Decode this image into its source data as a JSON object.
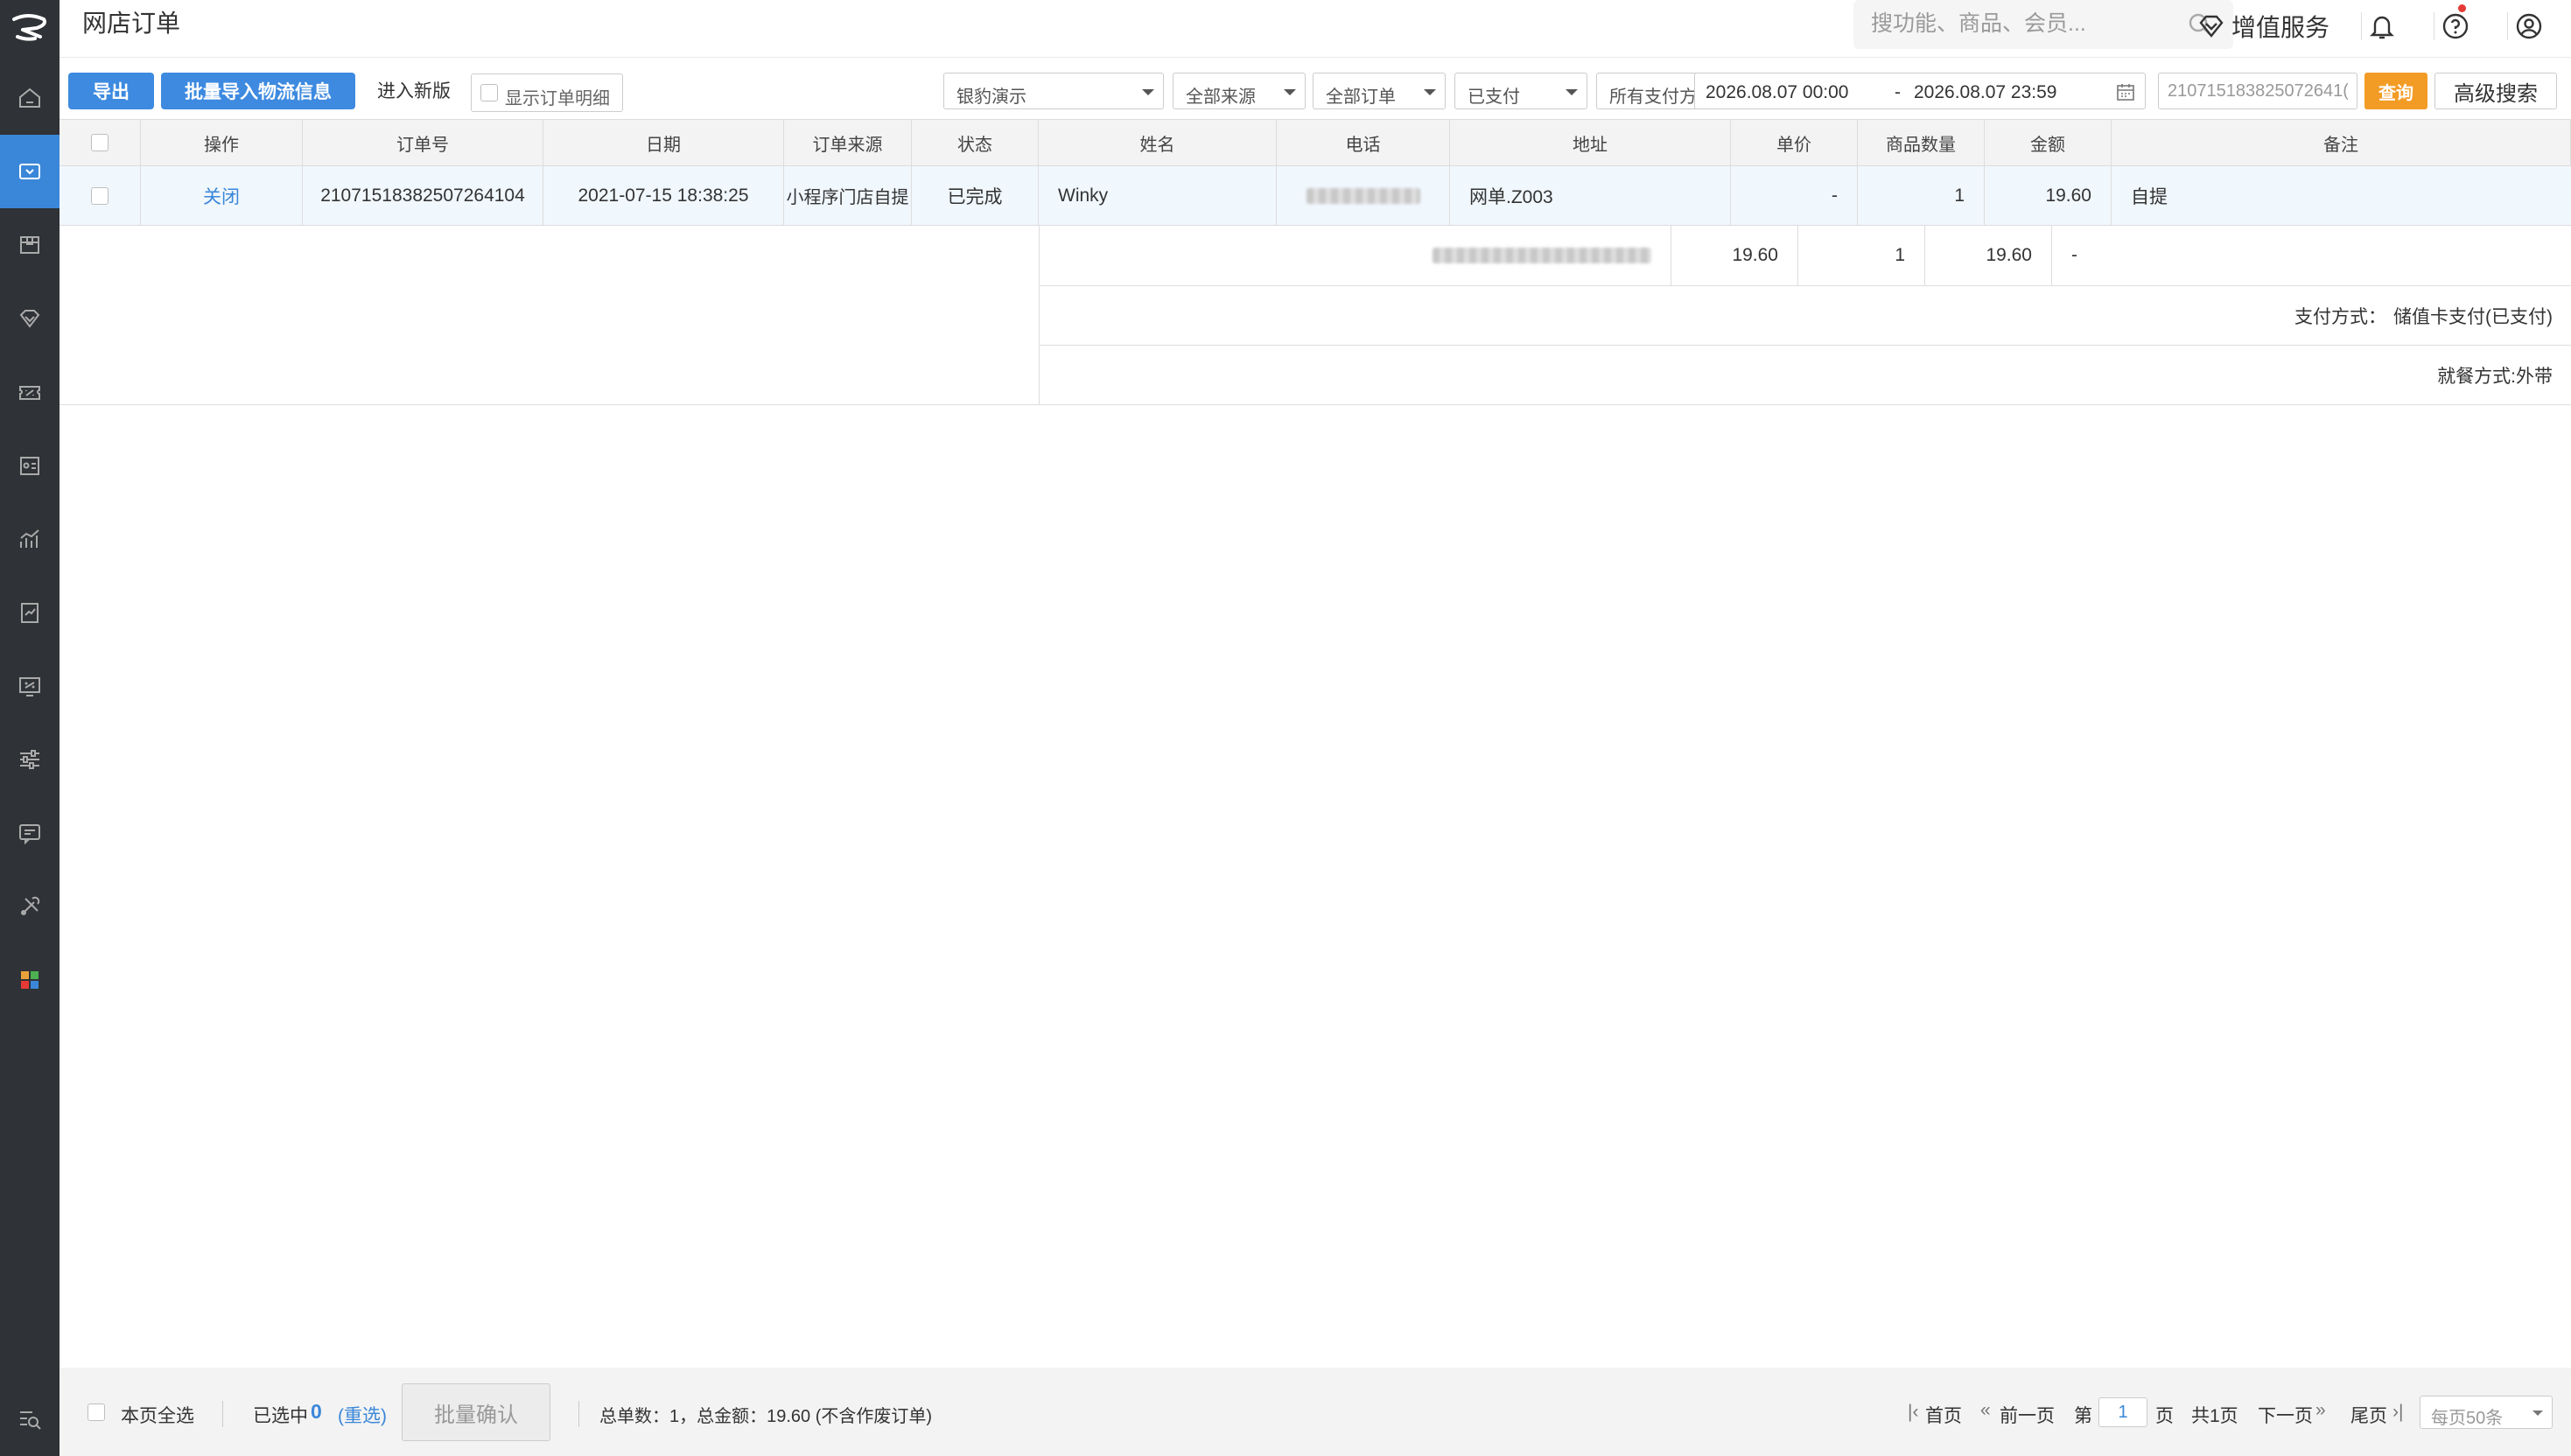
{
  "header": {
    "title": "网店订单",
    "search_placeholder": "搜功能、商品、会员...",
    "value_added_service": "增值服务"
  },
  "toolbar": {
    "export_label": "导出",
    "batch_import_label": "批量导入物流信息",
    "new_version_label": "进入新版",
    "show_details_label": "显示订单明细",
    "filters": {
      "store": "银豹演示",
      "source": "全部来源",
      "order_type": "全部订单",
      "pay_status": "已支付",
      "pay_method": "所有支付方式"
    },
    "date_start": "2026.08.07 00:00",
    "date_sep": "-",
    "date_end": "2026.08.07 23:59",
    "order_no_value": "210715183825072641(",
    "query_label": "查询",
    "advanced_search_label": "高级搜索"
  },
  "table": {
    "columns": [
      "操作",
      "订单号",
      "日期",
      "订单来源",
      "状态",
      "姓名",
      "电话",
      "地址",
      "单价",
      "商品数量",
      "金额",
      "备注"
    ],
    "order": {
      "action": "关闭",
      "order_no": "21071518382507264104",
      "date": "2021-07-15 18:38:25",
      "source": "小程序门店自提",
      "status": "已完成",
      "name": "Winky",
      "address": "网单.Z003",
      "unit_price": "-",
      "quantity": "1",
      "amount": "19.60",
      "remark": "自提"
    },
    "item": {
      "unit_price": "19.60",
      "quantity": "1",
      "amount": "19.60",
      "remark": "-"
    },
    "payment_label": "支付方式：",
    "payment_value": "储值卡支付(已支付)",
    "dining_label": "就餐方式:外带"
  },
  "footer": {
    "select_all_page": "本页全选",
    "selected_label": "已选中",
    "selected_count": "0",
    "reset_label": "(重选)",
    "batch_confirm": "批量确认",
    "summary": "总单数：1，总金额：19.60 (不含作废订单)",
    "first_page": "首页",
    "prev_page": "前一页",
    "page_prefix": "第",
    "current_page": "1",
    "page_suffix": "页",
    "total_pages": "共1页",
    "next_page": "下一页",
    "last_page": "尾页",
    "per_page": "每页50条"
  },
  "colors": {
    "sidebar_bg": "#2f3236",
    "accent_blue": "#3d8ae0",
    "query_orange": "#f39c25",
    "row_highlight": "#f0f7fd"
  },
  "sidebar_icons": [
    "logo-icon",
    "home-icon",
    "order-icon",
    "box-icon",
    "diamond-icon",
    "ticket-icon",
    "member-card-icon",
    "chart-icon",
    "report-icon",
    "discount-icon",
    "settings-sliders-icon",
    "message-icon",
    "tools-icon",
    "apps-icon",
    "search-list-icon"
  ]
}
